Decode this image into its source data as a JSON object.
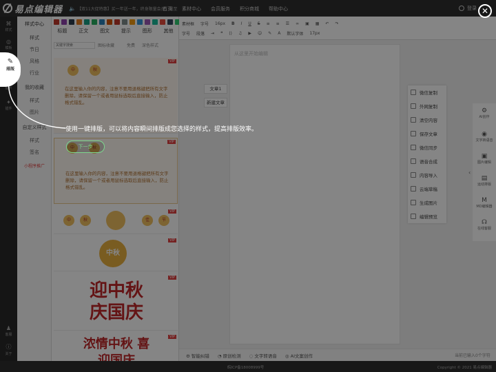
{
  "app": {
    "logo_text": "易点编辑器"
  },
  "topbar": {
    "notice": "【双11大促特惠】买一年送一年，终身限量会员，截至",
    "nav": [
      "首页",
      "素材中心",
      "会员服务",
      "积分商城",
      "帮助中心"
    ],
    "login": "登录"
  },
  "rail": {
    "items": [
      {
        "label": "样式",
        "icon": "palette-icon"
      },
      {
        "label": "模板",
        "icon": "template-icon"
      },
      {
        "label": "排版",
        "icon": "layout-icon"
      },
      {
        "label": "图片",
        "icon": "image-icon"
      },
      {
        "label": "插件",
        "icon": "plugin-icon"
      }
    ],
    "bottom": [
      {
        "label": "客服",
        "icon": "bell-icon"
      },
      {
        "label": "关于",
        "icon": "info-icon"
      }
    ]
  },
  "left_panel": {
    "header": "样式中心",
    "groups": [
      {
        "label": "样式"
      },
      {
        "label": "节日"
      },
      {
        "label": "风格"
      },
      {
        "label": "行业"
      },
      {
        "label": "我的收藏"
      },
      {
        "label": "样式"
      },
      {
        "label": "图片"
      },
      {
        "label": "自定义样式"
      },
      {
        "label": "样式"
      },
      {
        "label": "签名"
      }
    ],
    "promo": "小程序推广"
  },
  "template_panel": {
    "tabs": [
      "标题",
      "正文",
      "图文",
      "提示",
      "图形",
      "其他"
    ],
    "colors": [
      "#c0392b",
      "#8e44ad",
      "#2c3e50",
      "#e67e22",
      "#16a085",
      "#27ae60",
      "#2980b9",
      "#d35400",
      "#c0392b",
      "#7f8c8d",
      "#f39c12",
      "#3498db",
      "#9b59b6",
      "#1abc9c",
      "#e74c3c",
      "#34495e",
      "#2ecc71",
      "#95a5a6",
      "#e84393",
      "#00b894"
    ],
    "search_placeholder": "关键字搜索",
    "filter_labels": [
      "图标收藏",
      "免费",
      "深色样式"
    ],
    "cards": [
      {
        "badge": "VIP",
        "medals": [
          "中",
          "秋"
        ],
        "text": "在这里输入你的内容，注意不要用退格键把所有文字删除，请保留一个或者用鼠标选取后直接输入，防止格式错乱。"
      },
      {
        "badge": "VIP",
        "medals": [
          "中",
          "秋"
        ],
        "text": "在这里输入你的内容，注意不要用退格键把所有文字删除，请保留一个或者用鼠标选取后直接输入，防止格式错乱。"
      },
      {
        "badge": "VIP",
        "medals": [
          "中",
          "秋",
          "佳",
          "节"
        ]
      },
      {
        "badge": "VIP",
        "title": "中秋"
      },
      {
        "badge": "VIP",
        "title": "迎中秋 庆国庆"
      },
      {
        "badge": "VIP",
        "title": "浓情中秋 喜迎国庆"
      }
    ]
  },
  "toolbar": {
    "row1": [
      "素材框",
      "字号",
      "16px",
      "B",
      "I",
      "U",
      "S"
    ],
    "row2": [
      "字号",
      "段落",
      "默认字体",
      "17px"
    ]
  },
  "editor": {
    "placeholder": "从这里开始编辑",
    "article_tabs": [
      "文章1",
      "新建文章"
    ]
  },
  "actions": [
    {
      "label": "微信复制",
      "icon": "copy-icon"
    },
    {
      "label": "外网复制",
      "icon": "external-copy-icon"
    },
    {
      "label": "清空内容",
      "icon": "trash-icon"
    },
    {
      "label": "保存文章",
      "icon": "save-icon"
    },
    {
      "label": "微信同步",
      "icon": "upload-icon"
    },
    {
      "label": "语音合成",
      "icon": "voice-icon"
    },
    {
      "label": "内容导入",
      "icon": "import-icon"
    },
    {
      "label": "云端草稿",
      "icon": "cloud-icon"
    },
    {
      "label": "生成图片",
      "icon": "picture-icon"
    },
    {
      "label": "编辑预览",
      "icon": "preview-icon"
    }
  ],
  "right_tools": [
    {
      "label": "AI创作",
      "icon": "ai-icon"
    },
    {
      "label": "文字转语音",
      "icon": "tts-icon"
    },
    {
      "label": "图片编辑",
      "icon": "image-edit-icon"
    },
    {
      "label": "运动排版",
      "icon": "motion-icon"
    },
    {
      "label": "MD编辑器",
      "icon": "markdown-icon"
    },
    {
      "label": "在线客服",
      "icon": "support-icon"
    }
  ],
  "bottombar": {
    "items": [
      "智能纠错",
      "原创检测",
      "文字转语音",
      "AI文案创作"
    ],
    "word_count": "当前已输入0个字符"
  },
  "footer": {
    "icp": "皖ICP备18008999号",
    "copyright": "Copyright © 2021 易点编辑器"
  },
  "guide": {
    "tip": "使用一键排版，可以将内容瞬间排版成您选择的样式，提高排版效率。",
    "next_label": "下一步",
    "highlight_label": "排版",
    "close_symbol": "✕"
  }
}
